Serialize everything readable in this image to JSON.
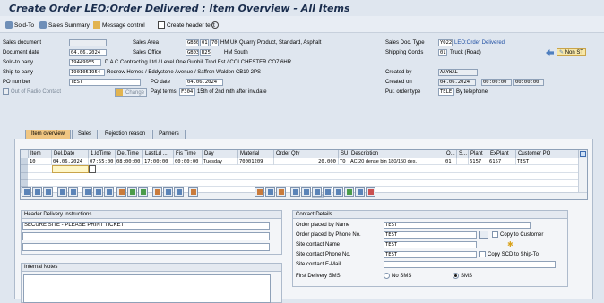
{
  "title": "Create Order LEO:Order Delivered : Item Overview - All Items",
  "toolbar": {
    "sold_to": "Sold-To",
    "sales_summary": "Sales Summary",
    "message_control": "Message control",
    "create_header_text": "Create header text"
  },
  "header": {
    "sales_document_label": "Sales document",
    "document_date_label": "Document date",
    "document_date": "04.06.2024",
    "sold_to_party_label": "Sold-to party",
    "sold_to_party": "19449955",
    "sold_to_party_desc": "D A C Contracting Ltd / Level One Gunhill Trod Est / COLCHESTER CO7 6HR",
    "ship_to_party_label": "Ship-to party",
    "ship_to_party": "1901051954",
    "ship_to_party_desc": "Redrow Homes / Eddystone Avenue / Saffron Walden CB10 2PS",
    "po_number_label": "PO number",
    "po_number": "TEST",
    "po_date_label": "PO date",
    "po_date": "04.06.2024",
    "out_of_radio_contact": "Out of Radio Contact",
    "change_button": "Change",
    "payt_terms_label": "Payt terms",
    "payt_terms": "F304",
    "payt_terms_desc": "15th of 2nd mth after inv.date",
    "sales_area_label": "Sales Area",
    "sales_area": [
      "GB30",
      "01",
      "70"
    ],
    "sales_area_desc": "HM UK Quarry Product, Standard, Asphalt",
    "sales_office_label": "Sales Office",
    "sales_office": "GB03",
    "sales_office_sub": "R25",
    "sales_office_desc": "HM South",
    "sales_doc_type_label": "Sales Doc. Type",
    "sales_doc_type": "YO22",
    "sales_doc_type_desc": "LEO:Order Delivered",
    "shipping_conds_label": "Shipping Conds",
    "shipping_conds": "01",
    "shipping_conds_desc": "Truck (Road)",
    "non_st": "Non ST",
    "created_by_label": "Created by",
    "created_by": "AAYWAL",
    "created_on_label": "Created on",
    "created_on": "04.06.2024",
    "created_time1": "00:00:00",
    "created_time2": "00:00:00",
    "pur_order_type_label": "Pur. order type",
    "pur_order_type": "TELE",
    "pur_order_type_desc": "By telephone"
  },
  "tabs": [
    "Item overview",
    "Sales",
    "Rejection reason",
    "Partners"
  ],
  "grid": {
    "columns": [
      "Item",
      "Del.Date",
      "1.ldTime",
      "Del.Time",
      "LastLd ...",
      "Fis Time",
      "Day",
      "Material",
      "Order Qty",
      "SU",
      "Description",
      "O...",
      "S...",
      "Plant",
      "ExPlant",
      "Customer PO"
    ],
    "rows": [
      [
        "10",
        "04.06.2024",
        "07:55:00",
        "08:00:00",
        "17:00:00",
        "00:00:00",
        "Tuesday",
        "70001209",
        "20.000",
        "TO",
        "AC 20 dense bin 180/150 des.",
        "01",
        "",
        "6157",
        "6157",
        "TEST"
      ]
    ]
  },
  "delivery": {
    "header": "Header Delivery Instructions",
    "line1": "SECURE SITE - PLEASE PRINT TICKET",
    "internal_notes": "Internal Notes"
  },
  "contact": {
    "header": "Contact Details",
    "order_by_name_label": "Order placed by Name",
    "order_by_name": "TEST",
    "order_by_phone_label": "Order placed by Phone No.",
    "order_by_phone": "TEST",
    "copy_to_customer": "Copy to Customer",
    "site_contact_name_label": "Site contact Name",
    "site_contact_name": "TEST",
    "site_contact_phone_label": "Site contact Phone No.",
    "site_contact_phone": "TEST",
    "copy_scd": "Copy SCD to Ship-To",
    "site_contact_email_label": "Site contact E-Mail",
    "first_delivery_sms_label": "First Delivery SMS",
    "no_sms": "No SMS",
    "sms": "SMS"
  },
  "colors": {
    "accent": "#f0c682",
    "title": "#1a2d4d"
  }
}
